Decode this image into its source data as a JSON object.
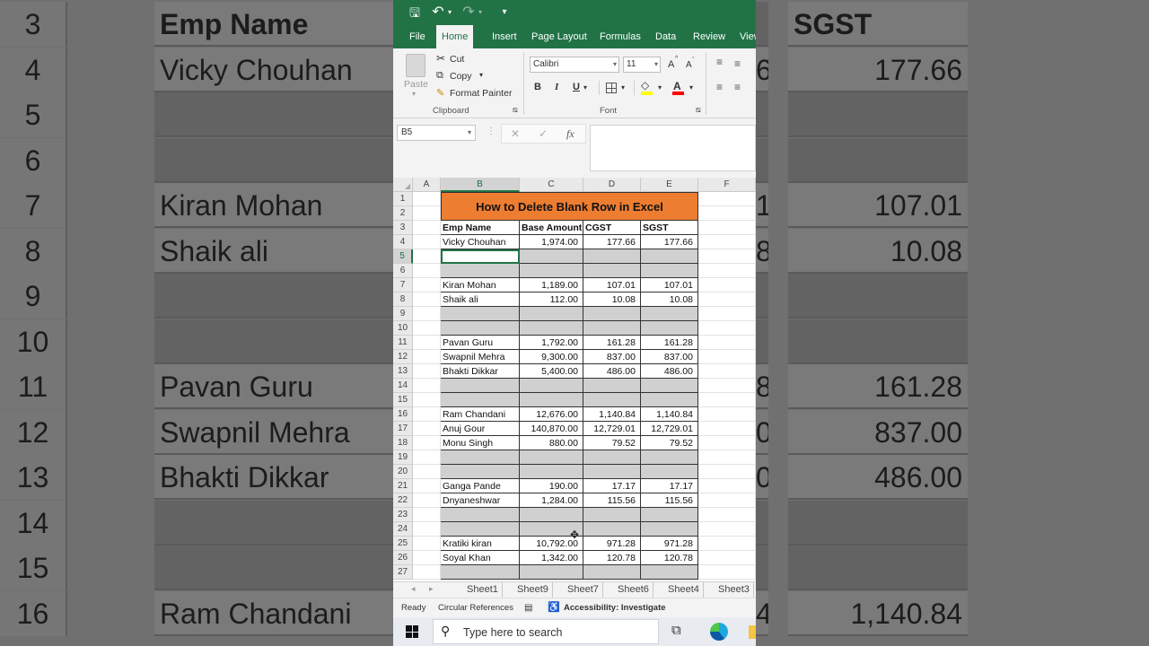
{
  "background": {
    "left_rows": [
      {
        "num": "3",
        "text": "Emp Name",
        "blank": false,
        "bold": true
      },
      {
        "num": "4",
        "text": "Vicky Chouhan",
        "blank": false
      },
      {
        "num": "5",
        "text": "",
        "blank": true
      },
      {
        "num": "6",
        "text": "",
        "blank": true
      },
      {
        "num": "7",
        "text": "Kiran Mohan",
        "blank": false
      },
      {
        "num": "8",
        "text": "Shaik ali",
        "blank": false
      },
      {
        "num": "9",
        "text": "",
        "blank": true
      },
      {
        "num": "10",
        "text": "",
        "blank": true
      },
      {
        "num": "11",
        "text": "Pavan  Guru",
        "blank": false
      },
      {
        "num": "12",
        "text": "Swapnil Mehra",
        "blank": false
      },
      {
        "num": "13",
        "text": "Bhakti Dikkar",
        "blank": false
      },
      {
        "num": "14",
        "text": "",
        "blank": true
      },
      {
        "num": "15",
        "text": "",
        "blank": true
      },
      {
        "num": "16",
        "text": "Ram Chandani",
        "blank": false
      }
    ],
    "right_rows": [
      {
        "frag": "",
        "text": "SGST",
        "blank": false,
        "bold": true
      },
      {
        "frag": "6",
        "text": "177.66",
        "blank": false
      },
      {
        "frag": "",
        "text": "",
        "blank": true
      },
      {
        "frag": "",
        "text": "",
        "blank": true
      },
      {
        "frag": "1",
        "text": "107.01",
        "blank": false
      },
      {
        "frag": "8",
        "text": "10.08",
        "blank": false
      },
      {
        "frag": "",
        "text": "",
        "blank": true
      },
      {
        "frag": "",
        "text": "",
        "blank": true
      },
      {
        "frag": "8",
        "text": "161.28",
        "blank": false
      },
      {
        "frag": "0",
        "text": "837.00",
        "blank": false
      },
      {
        "frag": "0",
        "text": "486.00",
        "blank": false
      },
      {
        "frag": "",
        "text": "",
        "blank": true
      },
      {
        "frag": "",
        "text": "",
        "blank": true
      },
      {
        "frag": "4",
        "text": "1,140.84",
        "blank": false
      }
    ]
  },
  "qat": {
    "save": "🖫",
    "undo": "↶",
    "redo": "↷",
    "customize": "▾"
  },
  "tabs": [
    "File",
    "Home",
    "Insert",
    "Page Layout",
    "Formulas",
    "Data",
    "Review",
    "View"
  ],
  "active_tab": "Home",
  "ribbon": {
    "paste": "Paste",
    "cut": "Cut",
    "copy": "Copy",
    "format_painter": "Format Painter",
    "clipboard_label": "Clipboard",
    "font_name": "Calibri",
    "font_size": "11",
    "grow_font": "A",
    "shrink_font": "A",
    "bold": "B",
    "italic": "I",
    "underline": "U",
    "font_label": "Font",
    "fill_color": "#ffff00",
    "font_color": "#ff0000"
  },
  "formula_bar": {
    "name_box": "B5",
    "cancel": "✕",
    "enter": "✓",
    "fx": "fx",
    "value": ""
  },
  "columns": [
    "A",
    "B",
    "C",
    "D",
    "E",
    "F"
  ],
  "title": "How to Delete Blank Row in Excel",
  "headers": [
    "Emp Name",
    "Base Amount",
    "CGST",
    "SGST"
  ],
  "rows": [
    {
      "row": "1",
      "type": "title"
    },
    {
      "row": "2",
      "type": "title"
    },
    {
      "row": "3",
      "type": "header"
    },
    {
      "row": "4",
      "type": "data",
      "cells": [
        "Vicky Chouhan",
        "1,974.00",
        "177.66",
        "177.66"
      ]
    },
    {
      "row": "5",
      "type": "blank"
    },
    {
      "row": "6",
      "type": "blank"
    },
    {
      "row": "7",
      "type": "data",
      "cells": [
        "Kiran Mohan",
        "1,189.00",
        "107.01",
        "107.01"
      ]
    },
    {
      "row": "8",
      "type": "data",
      "cells": [
        "Shaik ali",
        "112.00",
        "10.08",
        "10.08"
      ]
    },
    {
      "row": "9",
      "type": "blank"
    },
    {
      "row": "10",
      "type": "blank"
    },
    {
      "row": "11",
      "type": "data",
      "cells": [
        "Pavan  Guru",
        "1,792.00",
        "161.28",
        "161.28"
      ]
    },
    {
      "row": "12",
      "type": "data",
      "cells": [
        "Swapnil Mehra",
        "9,300.00",
        "837.00",
        "837.00"
      ]
    },
    {
      "row": "13",
      "type": "data",
      "cells": [
        "Bhakti Dikkar",
        "5,400.00",
        "486.00",
        "486.00"
      ]
    },
    {
      "row": "14",
      "type": "blank"
    },
    {
      "row": "15",
      "type": "blank"
    },
    {
      "row": "16",
      "type": "data",
      "cells": [
        "Ram Chandani",
        "12,676.00",
        "1,140.84",
        "1,140.84"
      ]
    },
    {
      "row": "17",
      "type": "data",
      "cells": [
        "Anuj Gour",
        "140,870.00",
        "12,729.01",
        "12,729.01"
      ]
    },
    {
      "row": "18",
      "type": "data",
      "cells": [
        "Monu Singh",
        "880.00",
        "79.52",
        "79.52"
      ]
    },
    {
      "row": "19",
      "type": "blank"
    },
    {
      "row": "20",
      "type": "blank"
    },
    {
      "row": "21",
      "type": "data",
      "cells": [
        "Ganga Pande",
        "190.00",
        "17.17",
        "17.17"
      ]
    },
    {
      "row": "22",
      "type": "data",
      "cells": [
        "Dnyaneshwar",
        "1,284.00",
        "115.56",
        "115.56"
      ]
    },
    {
      "row": "23",
      "type": "blank"
    },
    {
      "row": "24",
      "type": "blank"
    },
    {
      "row": "25",
      "type": "data",
      "cells": [
        "Kratiki kiran",
        "10,792.00",
        "971.28",
        "971.28"
      ]
    },
    {
      "row": "26",
      "type": "data",
      "cells": [
        "Soyal Khan",
        "1,342.00",
        "120.78",
        "120.78"
      ]
    },
    {
      "row": "27",
      "type": "blank"
    }
  ],
  "active_cell": "B5",
  "sheets": [
    "Sheet1",
    "Sheet9",
    "Sheet7",
    "Sheet6",
    "Sheet4",
    "Sheet3"
  ],
  "status": {
    "ready": "Ready",
    "circular": "Circular References",
    "accessibility": "Accessibility: Investigate"
  },
  "taskbar": {
    "search_placeholder": "Type here to search"
  },
  "colors": {
    "excel_green": "#217346",
    "title_fill": "#ed7d31",
    "blank_fill": "#d0d0d0"
  }
}
